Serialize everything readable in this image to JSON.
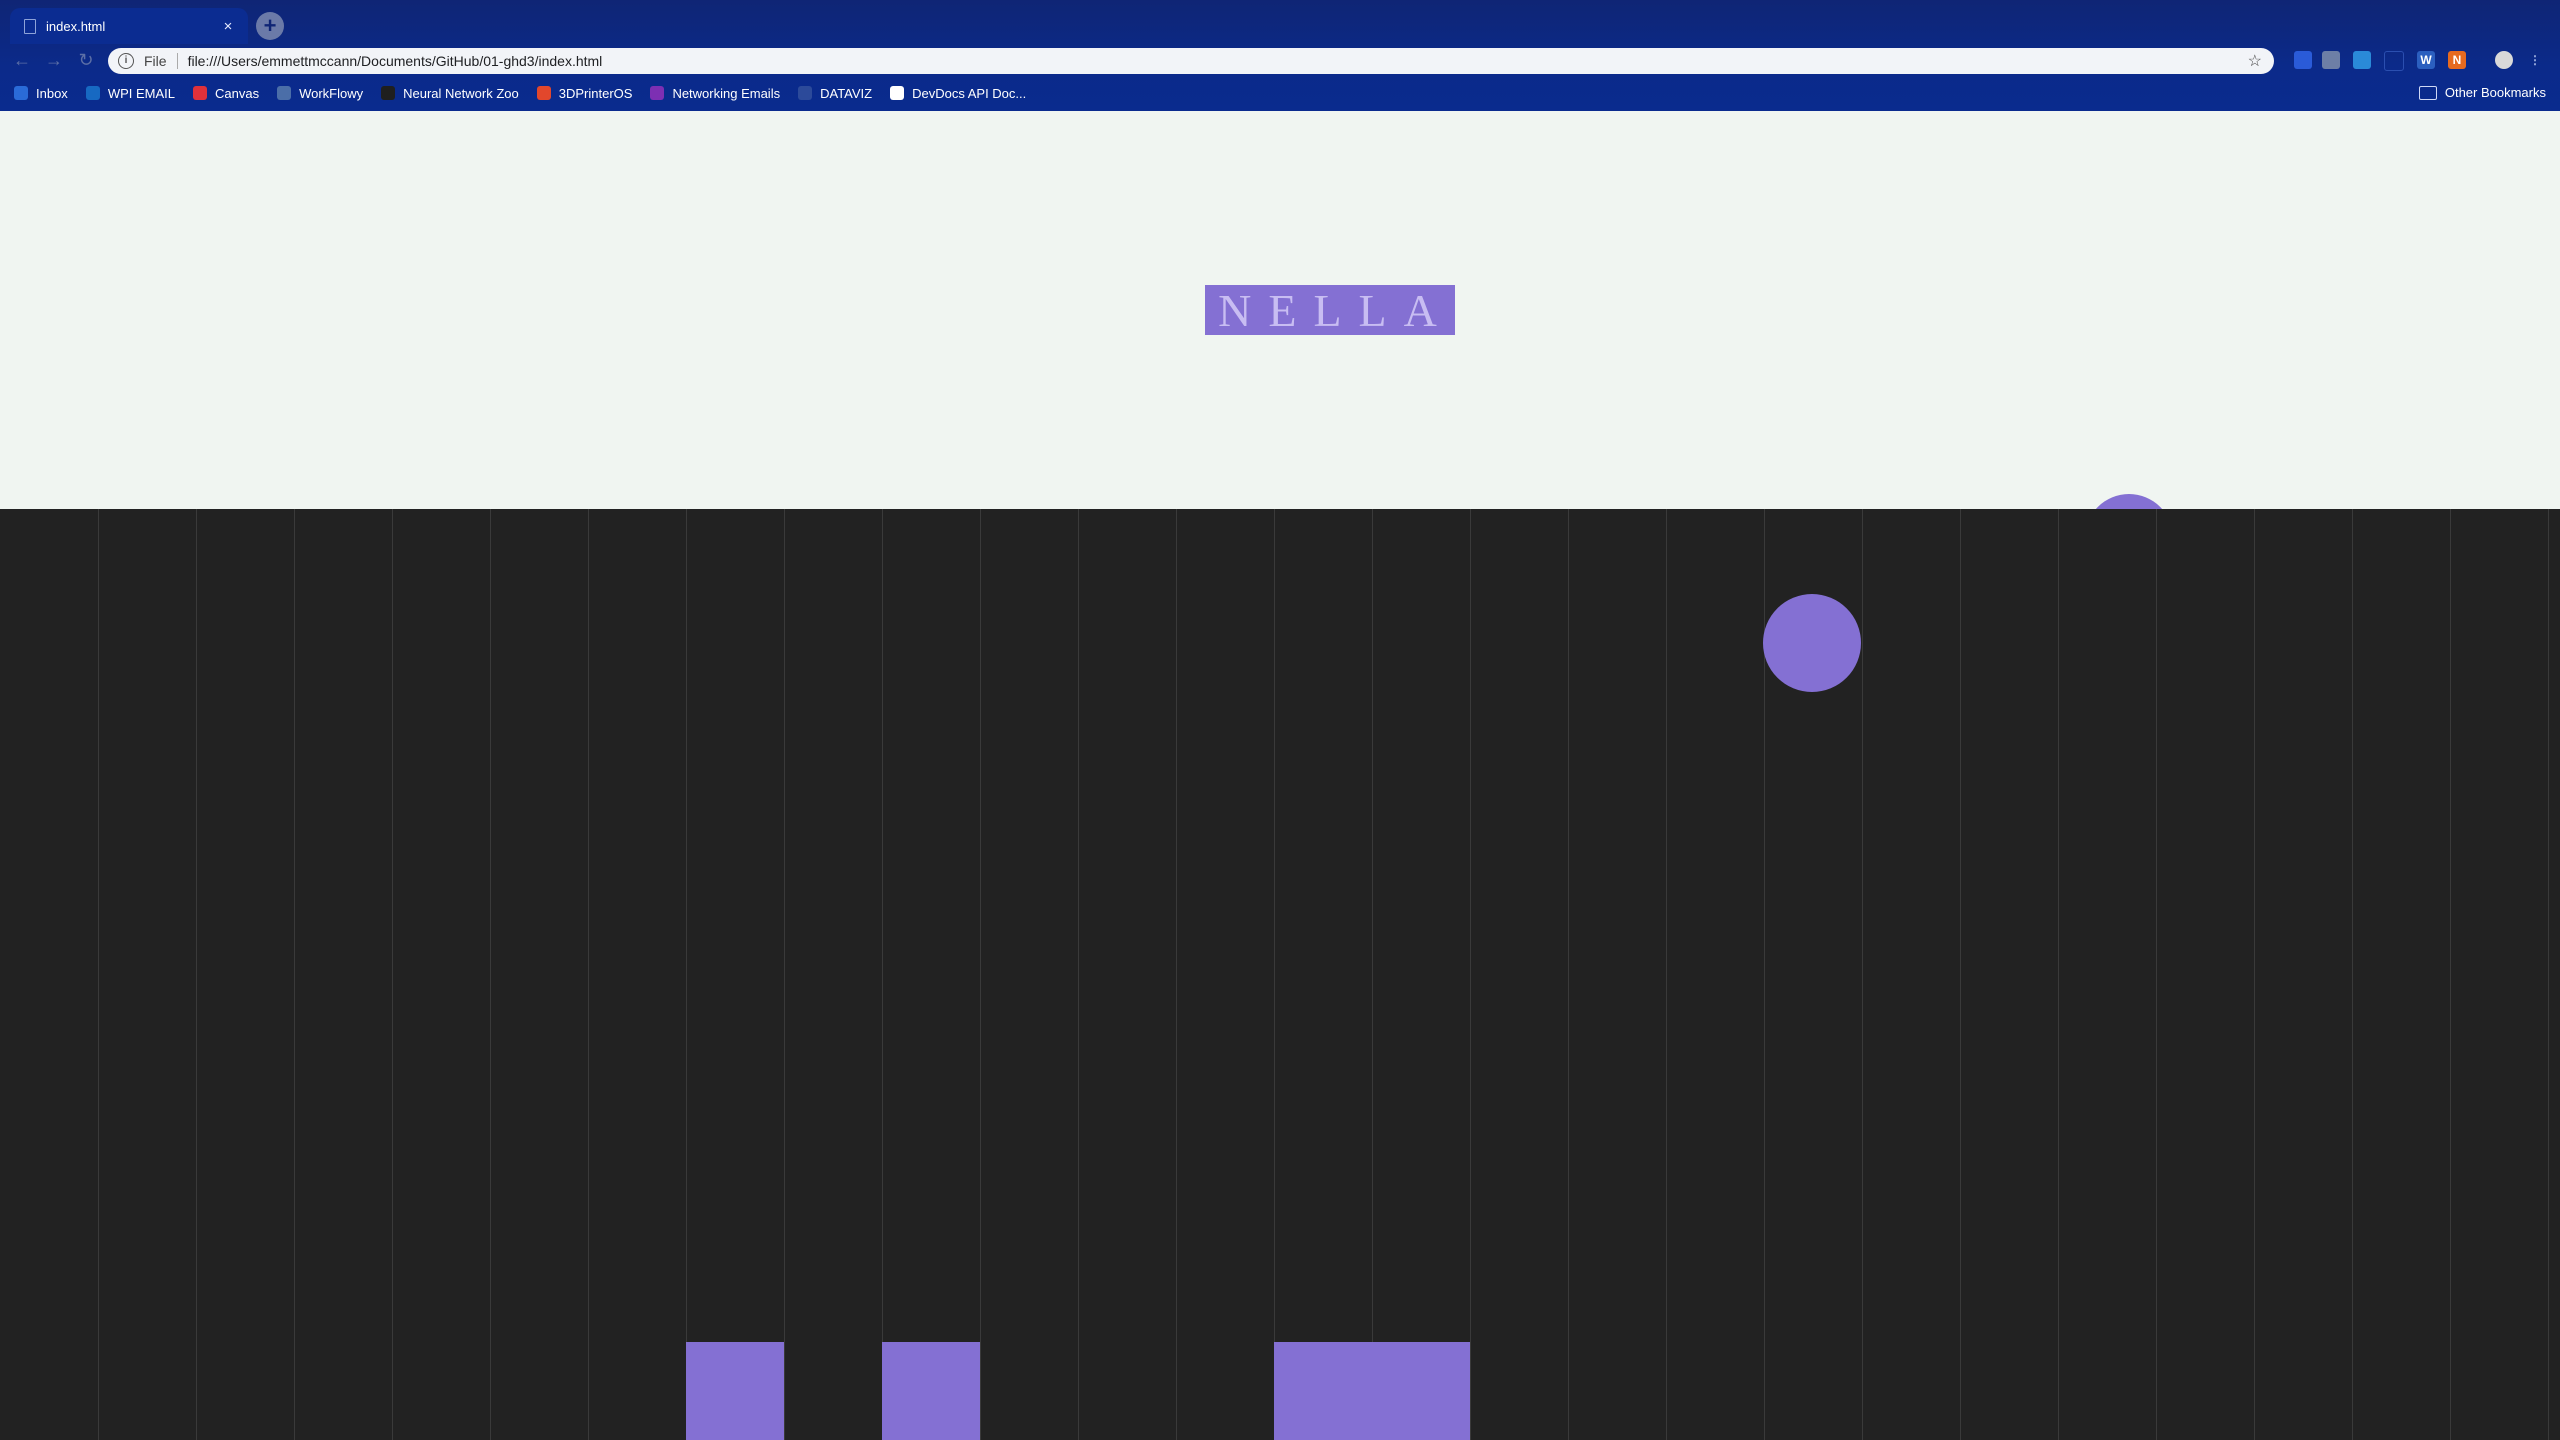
{
  "browser": {
    "tab": {
      "title": "index.html",
      "close": "×"
    },
    "new_tab": "+",
    "nav": {
      "back": "←",
      "forward": "→",
      "reload": "↻"
    },
    "address": {
      "info": "i",
      "scheme": "File",
      "url": "file:///Users/emmettmccann/Documents/GitHub/01-ghd3/index.html",
      "star": "☆"
    },
    "bookmarks": [
      {
        "label": "Inbox",
        "icon": "mail-icon",
        "color": "#2a6bd8"
      },
      {
        "label": "WPI EMAIL",
        "icon": "outlook-icon",
        "color": "#1769c2"
      },
      {
        "label": "Canvas",
        "icon": "canvas-icon",
        "color": "#e0313b"
      },
      {
        "label": "WorkFlowy",
        "icon": "workflowy-icon",
        "color": "#4b6ea8"
      },
      {
        "label": "Neural Network Zoo",
        "icon": "neural-network-icon",
        "color": "#1f1f1f"
      },
      {
        "label": "3DPrinterOS",
        "icon": "printer-icon",
        "color": "#e2472c"
      },
      {
        "label": "Networking Emails",
        "icon": "onenote-icon",
        "color": "#7d2fb3"
      },
      {
        "label": "DATAVIZ",
        "icon": "page-icon",
        "color": "#2c4a9a"
      },
      {
        "label": "DevDocs API Doc...",
        "icon": "devdocs-icon",
        "color": "#ffffff"
      }
    ],
    "other_bookmarks": "Other Bookmarks"
  },
  "page": {
    "logo_text": "NELLA",
    "accent_color": "#8470d3",
    "grid_columns": 26,
    "filled_columns": [
      7,
      9,
      13,
      14
    ]
  }
}
